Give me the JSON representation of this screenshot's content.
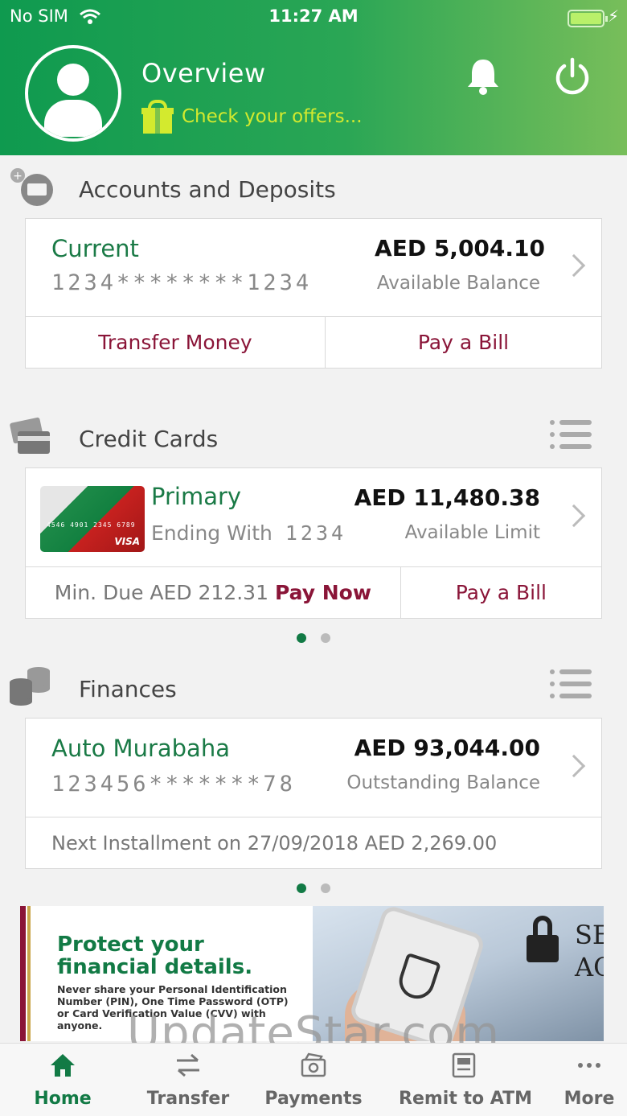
{
  "status_bar": {
    "carrier": "No SIM",
    "time": "11:27 AM"
  },
  "header": {
    "title": "Overview",
    "offers_link": "Check your offers..."
  },
  "accounts": {
    "title": "Accounts and Deposits",
    "account": {
      "name": "Current",
      "number": "1234********1234",
      "amount": "AED 5,004.10",
      "amount_label": "Available Balance"
    },
    "actions": {
      "transfer": "Transfer Money",
      "pay_bill": "Pay a Bill"
    }
  },
  "credit_cards": {
    "title": "Credit Cards",
    "card": {
      "name": "Primary",
      "ending_label": "Ending With",
      "ending_digits": "1234",
      "amount": "AED 11,480.38",
      "amount_label": "Available Limit",
      "image_number": "4546 4901 2345 6789",
      "image_brand": "VISA"
    },
    "min_due": "Min. Due AED 212.31",
    "pay_now": "Pay Now",
    "pay_bill": "Pay a Bill"
  },
  "finances": {
    "title": "Finances",
    "item": {
      "name": "Auto Murabaha",
      "number": "123456*******78",
      "amount": "AED 93,044.00",
      "amount_label": "Outstanding Balance"
    },
    "next_installment": "Next Installment on 27/09/2018 AED 2,269.00"
  },
  "banner": {
    "headline": "Protect your financial details.",
    "body": "Never share your Personal Identification Number (PIN), One Time Password (OTP) or Card Verification Value (CVV) with anyone.",
    "photo_text": "SE AC"
  },
  "watermark": "UpdateStar.com",
  "tabs": [
    {
      "label": "Home",
      "icon": "home-icon"
    },
    {
      "label": "Transfer",
      "icon": "transfer-icon"
    },
    {
      "label": "Payments",
      "icon": "payments-icon"
    },
    {
      "label": "Remit to ATM",
      "icon": "atm-icon"
    },
    {
      "label": "More",
      "icon": "more-icon"
    }
  ],
  "colors": {
    "brand_green": "#127a45",
    "accent_maroon": "#8a1538",
    "offer_yellow": "#d3ea2e"
  }
}
